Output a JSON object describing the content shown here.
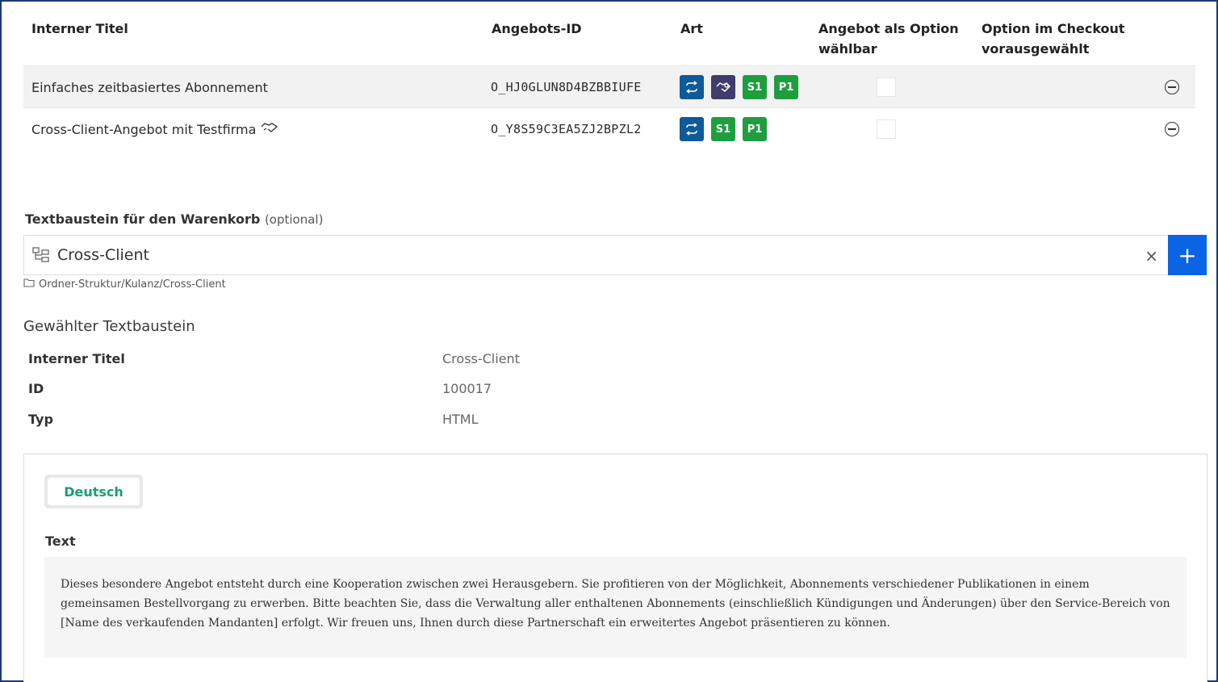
{
  "table": {
    "headers": {
      "title": "Interner Titel",
      "offer_id": "Angebots-ID",
      "kind": "Art",
      "selectable": "Angebot als Option wählbar",
      "preselected": "Option im Checkout vorausgewählt"
    },
    "rows": [
      {
        "title": "Einfaches zeitbasiertes Abonnement",
        "offer_id": "O_HJ0GLUN8D4BZBBIUFE",
        "badges": [
          "repeat-icon",
          "handshake-icon",
          "S1",
          "P1"
        ]
      },
      {
        "title": "Cross-Client-Angebot mit Testfirma",
        "title_icon": "handshake-icon",
        "offer_id": "O_Y8S59C3EA5ZJ2BPZL2",
        "badges": [
          "repeat-icon",
          "S1",
          "P1"
        ]
      }
    ]
  },
  "cart_snippet": {
    "label": "Textbaustein für den Warenkorb",
    "optional": "(optional)",
    "value": "Cross-Client",
    "path": "Ordner-Struktur/Kulanz/Cross-Client",
    "add_label": "+",
    "clear_label": "×"
  },
  "selected": {
    "heading": "Gewählter Textbaustein",
    "fields": [
      {
        "key": "Interner Titel",
        "value": "Cross-Client"
      },
      {
        "key": "ID",
        "value": "100017"
      },
      {
        "key": "Typ",
        "value": "HTML"
      }
    ]
  },
  "content": {
    "tab": "Deutsch",
    "text_label": "Text",
    "text": "Dieses besondere Angebot entsteht durch eine Kooperation zwischen zwei Herausgebern. Sie profitieren von der Möglichkeit, Abonnements verschiedener Publikationen in einem gemeinsamen Bestellvorgang zu erwerben. Bitte beachten Sie, dass die Verwaltung aller enthaltenen Abonnements (einschließlich Kündigungen und Änderungen) über den Service-Bereich von [Name des verkaufenden Mandanten] erfolgt. Wir freuen uns, Ihnen durch diese Partnerschaft ein erweitertes Angebot präsentieren zu können."
  },
  "colors": {
    "badge_blue": "#0f5a98",
    "badge_purple": "#3f3d6b",
    "badge_green": "#1e9e3f",
    "add_button": "#0b63e5",
    "tab_text": "#1a9e6e"
  }
}
